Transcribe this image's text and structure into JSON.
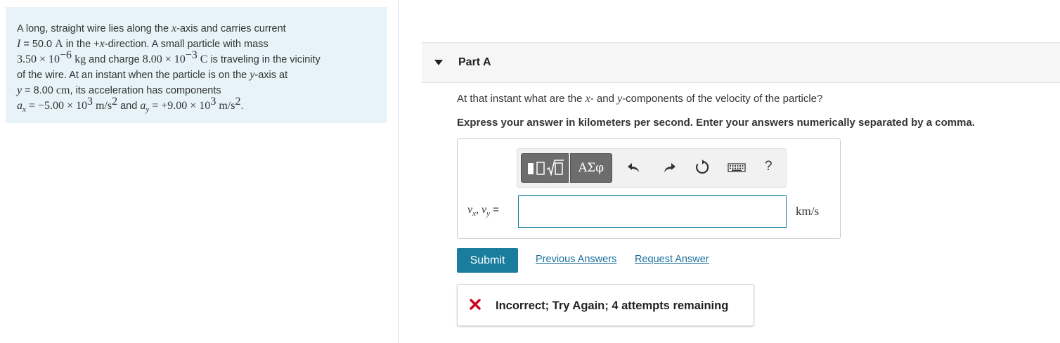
{
  "problem": {
    "line1": "A long, straight wire lies along the ",
    "line1_var": "x",
    "line1_end": "-axis and carries current",
    "line2_var": "I",
    "line2_eq": " = 50.0 ",
    "line2_unit": "A",
    "line2_mid": " in the +",
    "line2_var2": "x",
    "line2_end": "-direction. A small particle with mass",
    "line3_mass": "3.50 × 10",
    "line3_mass_exp": "−6",
    "line3_mass_unit": " kg",
    "line3_mid": " and charge ",
    "line3_charge": "8.00 × 10",
    "line3_charge_exp": "−3",
    "line3_charge_unit": " C",
    "line3_end": " is traveling in the vicinity",
    "line4": "of the wire. At an instant when the particle is on the ",
    "line4_var": "y",
    "line4_end": "-axis at",
    "line5_var": "y",
    "line5_eq": " = 8.00 ",
    "line5_unit": "cm",
    "line5_end": ", its acceleration has components",
    "line6_ax": "a",
    "line6_ax_sub": "x",
    "line6_ax_val": " = −5.00 × 10",
    "line6_ax_exp": "3",
    "line6_ax_unit": " m/s",
    "line6_ax_unit_exp": "2",
    "line6_and": " and ",
    "line6_ay": "a",
    "line6_ay_sub": "y",
    "line6_ay_val": " = +9.00 × 10",
    "line6_ay_exp": "3",
    "line6_ay_unit": " m/s",
    "line6_ay_unit_exp": "2",
    "line6_end": "."
  },
  "part": {
    "title": "Part A",
    "question_start": "At that instant what are the ",
    "question_var1": "x",
    "question_mid": "- and ",
    "question_var2": "y",
    "question_end": "-components of the velocity of the particle?",
    "instruction": "Express your answer in kilometers per second. Enter your answers numerically separated by a comma."
  },
  "answer": {
    "label_v": "v",
    "label_x": "x",
    "label_sep": ", ",
    "label_y": "y",
    "label_eq": " =",
    "value": "",
    "unit": "km/s"
  },
  "toolbar": {
    "greek_label": "ΑΣφ",
    "help_label": "?",
    "icons": [
      "templates-icon",
      "greek-symbols",
      "undo-icon",
      "redo-icon",
      "reset-icon",
      "keyboard-icon",
      "help-icon"
    ]
  },
  "actions": {
    "submit_label": "Submit",
    "previous_answers": "Previous Answers",
    "request_answer": "Request Answer"
  },
  "feedback": {
    "text": "Incorrect; Try Again; 4 attempts remaining",
    "icon": "x-mark-icon",
    "icon_color": "#d0021b"
  },
  "colors": {
    "panel_bg": "#e7f3f8",
    "accent": "#1a7d9e",
    "link": "#1a6f9e"
  }
}
